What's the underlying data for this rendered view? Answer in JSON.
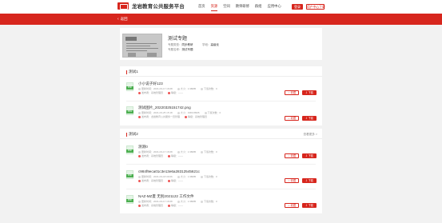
{
  "header": {
    "site_title": "龙岩教育公共服务平台",
    "nav": [
      "首页",
      "资源",
      "空间",
      "教师研修",
      "群组",
      "应用中心"
    ],
    "active_nav": "资源",
    "login_label": "登录",
    "user_center_label": "用户中心下载"
  },
  "breadcrumb": {
    "back_label": "返回"
  },
  "topic": {
    "title": "测试专题",
    "meta_line1": {
      "k1": "专题类型：",
      "v1": "同步教研",
      "k2": "学段：",
      "v2": "高级化"
    },
    "meta_line2": {
      "k": "专题名称：",
      "v": "测试专题"
    }
  },
  "sections": [
    {
      "title": "测试1",
      "items": [
        {
          "title": "小小说子好123",
          "date": "更新时间：2021-03-17 16:08",
          "size": "大小：1.98MB",
          "downloads": "下载次数：0",
          "author": "发布者：系统管理员",
          "level": "等级：——",
          "type": "PDF"
        },
        {
          "title": "测试图片_20220325151742.png",
          "date": "更新时间：2021-03-25 15:18",
          "size": "大小：1983.86KB",
          "downloads": "下载次数：0",
          "author": "发布者：龙岩教育公共服务一员管理",
          "level": "等级：系统管理员",
          "type": "PNG"
        }
      ]
    },
    {
      "title": "测试2",
      "more_label": "查看更多 >",
      "items": [
        {
          "title": "测测0",
          "date": "更新时间：2021-03-17 16:08",
          "size": "大小：1.98MB",
          "downloads": "下载次数：0",
          "author": "发布者：系统管理员",
          "level": "等级：——",
          "type": "PDF"
        },
        {
          "title": "c984f9eca01c3e13e6a28312545621c",
          "date": "更新时间：2021-03-18 09:06",
          "size": "大小：1.98MB",
          "downloads": "下载次数：0",
          "author": "发布者：系统管理员",
          "level": "等级：——",
          "type": "PDF"
        },
        {
          "title": "NAZ-MZ夏 无别2021122 工作文件",
          "date": "更新时间：2021-03-17 16:08",
          "size": "大小：1.98MB",
          "downloads": "下载次数：0",
          "author": "发布者：系统管理员",
          "level": "等级：——",
          "type": "PDF"
        }
      ]
    }
  ],
  "buttons": {
    "favorite": "☆ 收藏",
    "download": "⇩ 下载"
  },
  "colors": {
    "brand_red": "#d7261d",
    "file_green": "#4caf50",
    "page_bg": "#f2f2f2"
  }
}
